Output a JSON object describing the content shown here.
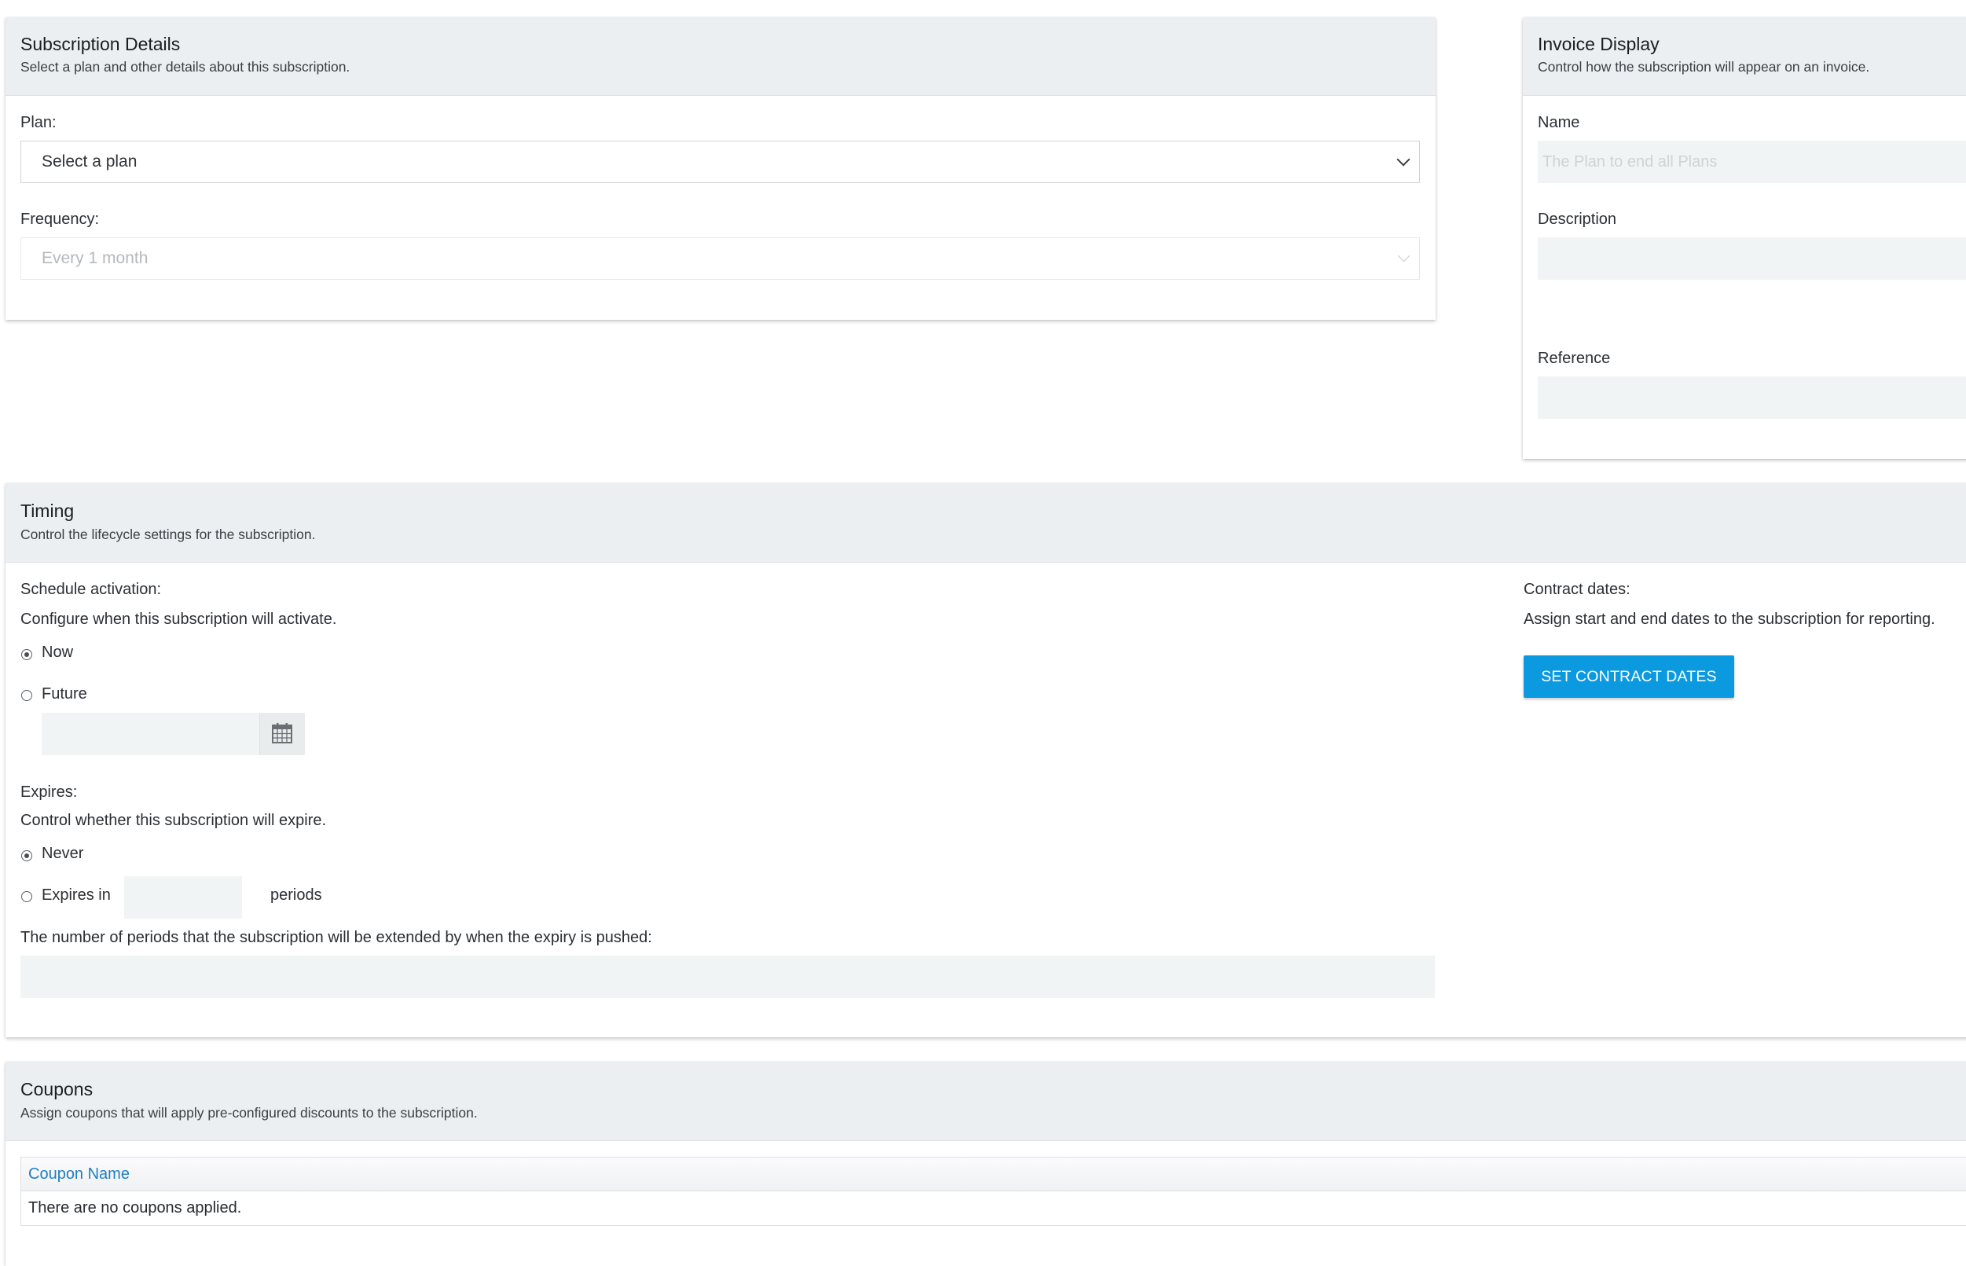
{
  "subscription_details": {
    "title": "Subscription Details",
    "subtitle": "Select a plan and other details about this subscription.",
    "plan_label": "Plan:",
    "plan_value": "Select a plan",
    "frequency_label": "Frequency:",
    "frequency_value": "Every 1 month"
  },
  "invoice_display": {
    "title": "Invoice Display",
    "subtitle": "Control how the subscription will appear on an invoice.",
    "name_label": "Name",
    "name_placeholder": "The Plan to end all Plans",
    "description_label": "Description",
    "reference_label": "Reference"
  },
  "timing": {
    "title": "Timing",
    "subtitle": "Control the lifecycle settings for the subscription.",
    "schedule_label": "Schedule activation:",
    "schedule_help": "Configure when this subscription will activate.",
    "now_label": "Now",
    "future_label": "Future",
    "expires_label": "Expires:",
    "expires_help": "Control whether this subscription will expire.",
    "never_label": "Never",
    "expires_in_label": "Expires in",
    "periods_label": "periods",
    "extend_label": "The number of periods that the subscription will be extended by when the expiry is pushed:",
    "contract_label": "Contract dates:",
    "contract_help": "Assign start and end dates to the subscription for reporting.",
    "contract_button": "SET CONTRACT DATES",
    "selected_activation": "Now",
    "selected_expiry": "Never"
  },
  "coupons": {
    "title": "Coupons",
    "subtitle": "Assign coupons that will apply pre-configured discounts to the subscription.",
    "column_header": "Coupon Name",
    "empty_text": "There are no coupons applied."
  },
  "colors": {
    "accent": "#0b9ae0",
    "header_bg": "#eceff1",
    "link": "#1f7fbf"
  }
}
